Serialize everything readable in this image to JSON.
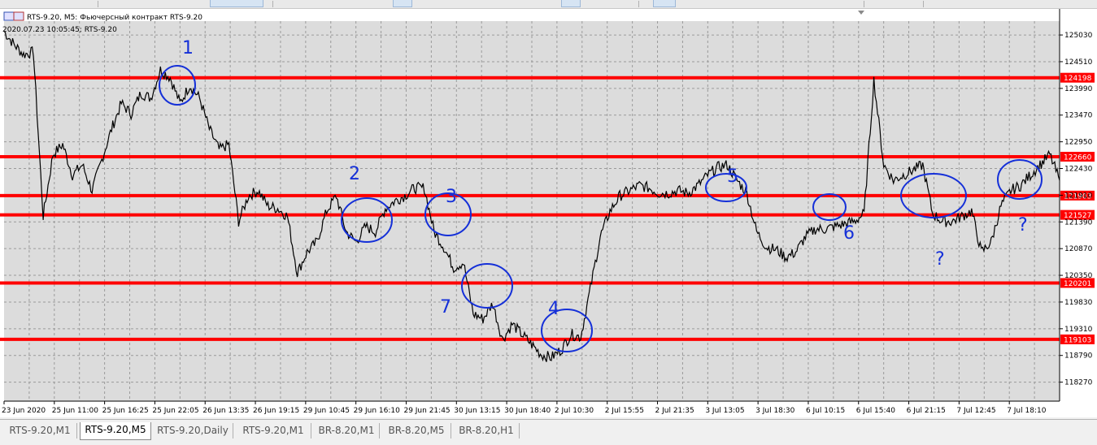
{
  "window": {
    "title": "RTS-9.20, M5:  Фьючерсный контракт RTS-9.20",
    "subtitle": "2020.07.23 10:05:45; RTS-9.20"
  },
  "colors": {
    "background": "#ffffff",
    "plot_bg": "#dcdcdc",
    "grid": "#9a9a9a",
    "price": "#000000",
    "level": "#ff0000",
    "annotation": "#1530d8"
  },
  "annotations": [
    "1",
    "2",
    "3",
    "4",
    "5",
    "6",
    "7",
    "?",
    "?",
    "?"
  ],
  "tabs": [
    {
      "label": "RTS-9.20,M1",
      "active": false
    },
    {
      "label": "RTS-9.20,M5",
      "active": true
    },
    {
      "label": "RTS-9.20,Daily",
      "active": false
    },
    {
      "label": "RTS-9.20,M1",
      "active": false
    },
    {
      "label": "BR-8.20,M1",
      "active": false
    },
    {
      "label": "BR-8.20,M5",
      "active": false
    },
    {
      "label": "BR-8.20,H1",
      "active": false
    }
  ],
  "chart_data": {
    "type": "line",
    "ylim": [
      117900,
      125300
    ],
    "y_ticks": [
      125030,
      124510,
      123990,
      123470,
      122950,
      122430,
      121910,
      121390,
      120870,
      120350,
      119830,
      119310,
      118790,
      118270
    ],
    "x_ticks": [
      "23 Jun 2020",
      "25 Jun 11:00",
      "25 Jun 16:25",
      "25 Jun 22:05",
      "26 Jun 13:35",
      "26 Jun 19:15",
      "29 Jun 10:45",
      "29 Jun 16:10",
      "29 Jun 21:45",
      "30 Jun 13:15",
      "30 Jun 18:40",
      "2 Jul 10:30",
      "2 Jul 15:55",
      "2 Jul 21:35",
      "3 Jul 13:05",
      "3 Jul 18:30",
      "6 Jul 10:15",
      "6 Jul 15:40",
      "6 Jul 21:15",
      "7 Jul 12:45",
      "7 Jul 18:10"
    ],
    "levels": [
      124198,
      122660,
      121903,
      121527,
      120201,
      119103
    ],
    "level_labels": [
      "124198",
      "122660",
      "121903",
      "121527",
      "120201",
      "119103"
    ],
    "series": [
      {
        "values": [
          125100,
          124850,
          124650,
          124700,
          121500,
          122700,
          122900,
          122300,
          122500,
          122000,
          122600,
          123200,
          123700,
          123500,
          123900,
          123800,
          124350,
          124200,
          123700,
          124050,
          123800,
          123200,
          122800,
          122900,
          121400,
          121900,
          122000,
          121700,
          121650,
          121500,
          120400,
          120800,
          121000,
          121600,
          121900,
          121200,
          121000,
          121300,
          121200,
          121650,
          121800,
          121900,
          122050,
          122050,
          121200,
          120900,
          120500,
          120600,
          119600,
          119500,
          119800,
          119100,
          119400,
          119200,
          119000,
          118800,
          118750,
          118900,
          119200,
          119150,
          120100,
          121100,
          121600,
          121900,
          122000,
          122100,
          122050,
          121950,
          121950,
          122000,
          121950,
          122100,
          122300,
          122450,
          122500,
          122200,
          121950,
          121200,
          120900,
          120850,
          120700,
          120800,
          121100,
          121250,
          121250,
          121300,
          121350,
          121400,
          121550,
          124150,
          122500,
          122200,
          122300,
          122400,
          122500,
          121550,
          121400,
          121400,
          121500,
          121600,
          120800,
          121000,
          121700,
          122000,
          122100,
          122300,
          122500,
          122700,
          122200
        ]
      }
    ]
  }
}
